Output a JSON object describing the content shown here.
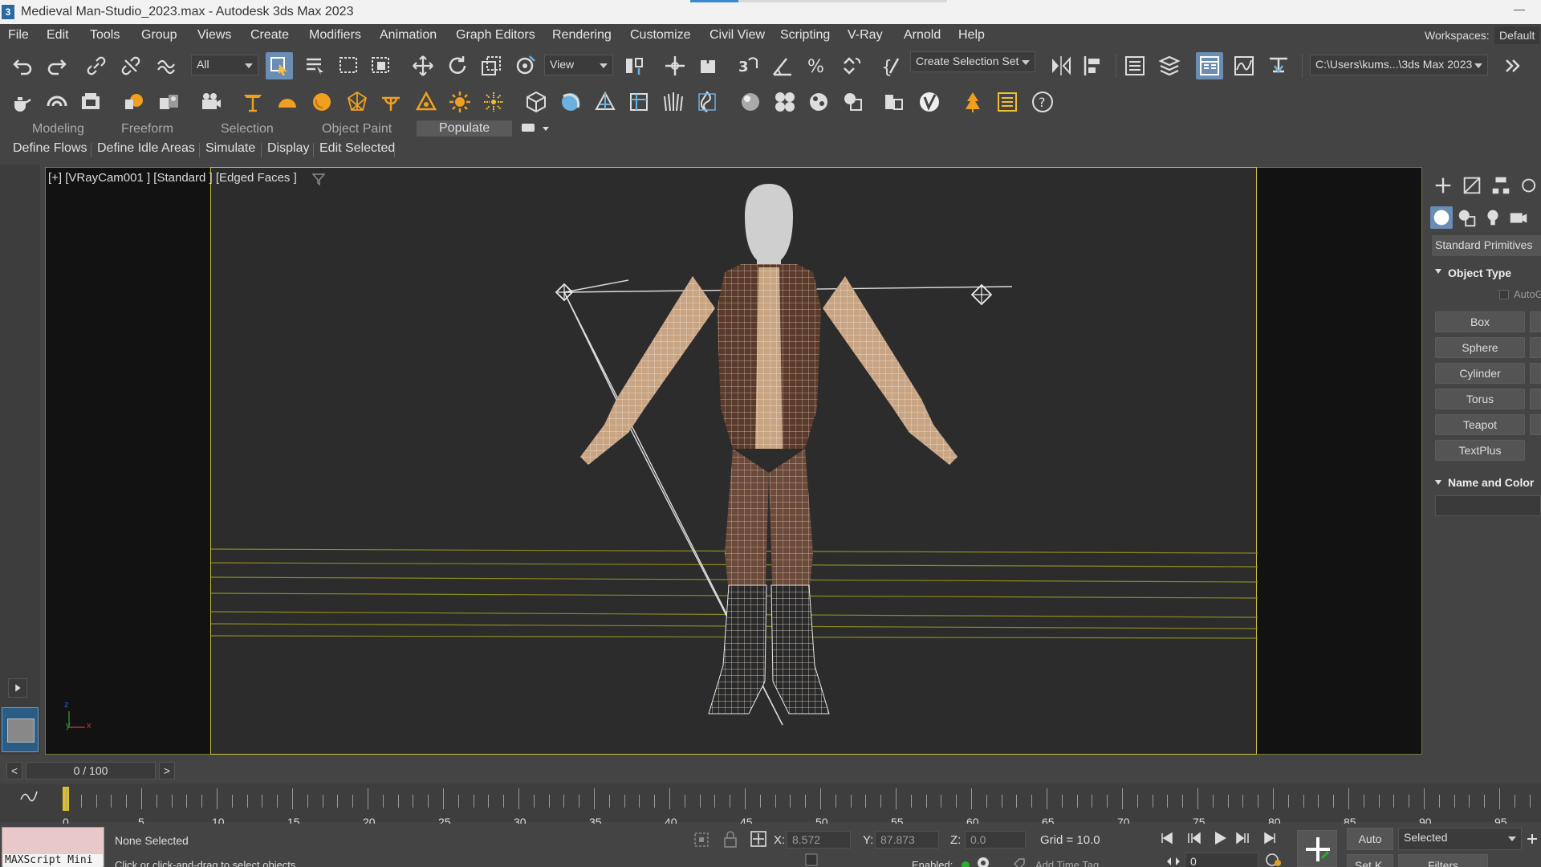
{
  "window": {
    "title": "Medieval Man-Studio_2023.max - Autodesk 3ds Max 2023",
    "app_icon": "3"
  },
  "menu": {
    "items": [
      "File",
      "Edit",
      "Tools",
      "Group",
      "Views",
      "Create",
      "Modifiers",
      "Animation",
      "Graph Editors",
      "Rendering",
      "Customize",
      "Civil View",
      "Scripting",
      "V-Ray",
      "Arnold",
      "Help"
    ],
    "workspaces_label": "Workspaces:",
    "workspace_value": "Default"
  },
  "toolbar": {
    "selection_filter": "All",
    "ref_coord": "View",
    "named_selection": "Create Selection Set",
    "project_path": "C:\\Users\\kums...\\3ds Max 2023"
  },
  "ribbon": {
    "tabs": [
      "Modeling",
      "Freeform",
      "Selection",
      "Object Paint",
      "Populate"
    ],
    "active_tab": "Populate",
    "sub_tabs": [
      "Define Flows",
      "Define Idle Areas",
      "Simulate",
      "Display",
      "Edit Selected"
    ]
  },
  "viewport": {
    "label": "[+] [VRayCam001 ] [Standard ] [Edged Faces ]",
    "axis_x": "x",
    "axis_y": "y",
    "axis_z": "z"
  },
  "command_panel": {
    "category": "Standard Primitives",
    "object_type_title": "Object Type",
    "autogrid": "AutoGrid",
    "buttons": [
      "Box",
      "Sphere",
      "Cylinder",
      "Torus",
      "Teapot",
      "TextPlus"
    ],
    "name_color_title": "Name and Color"
  },
  "timeline": {
    "slider_text": "0 / 100",
    "prev": "<",
    "next": ">",
    "tick_labels": [
      "0",
      "5",
      "10",
      "15",
      "20",
      "25",
      "30",
      "35",
      "40",
      "45",
      "50",
      "55",
      "60",
      "65",
      "70",
      "75",
      "80",
      "85",
      "90",
      "95"
    ]
  },
  "status": {
    "selection": "None Selected",
    "prompt": "Click or click-and-drag to select objects",
    "maxscript": "MAXScript Mini",
    "x_label": "X:",
    "x_value": "8.572",
    "y_label": "Y:",
    "y_value": "87.873",
    "z_label": "Z:",
    "z_value": "0.0",
    "grid": "Grid = 10.0",
    "auto": "Auto",
    "set_key": "Set K.",
    "selected_dd": "Selected",
    "filters": "Filters",
    "frame": "0",
    "enabled_label": "Enabled:",
    "add_time_tag": "Add Time Tag"
  },
  "colors": {
    "accent": "#c9c13a",
    "active_button": "#6a8db4",
    "wireframe": "#e8e8e8",
    "skin": "#c8a483",
    "vest": "#5a3a2a"
  }
}
